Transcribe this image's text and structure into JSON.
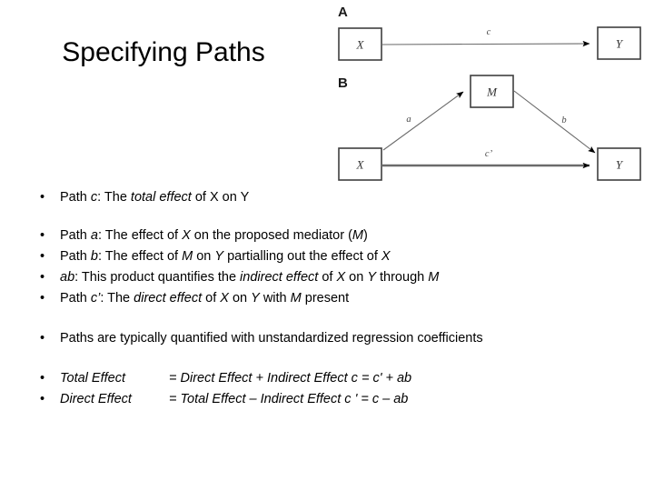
{
  "slide": {
    "title": "Specifying Paths"
  },
  "diagram": {
    "panel_a": {
      "label": "A",
      "nodes": [
        {
          "id": "x",
          "label": "X"
        },
        {
          "id": "y",
          "label": "Y"
        }
      ],
      "edges": [
        {
          "from": "X",
          "to": "Y",
          "label": "c"
        }
      ]
    },
    "panel_b": {
      "label": "B",
      "nodes": [
        {
          "id": "x",
          "label": "X"
        },
        {
          "id": "m",
          "label": "M"
        },
        {
          "id": "y",
          "label": "Y"
        }
      ],
      "edges": [
        {
          "from": "X",
          "to": "M",
          "label": "a"
        },
        {
          "from": "M",
          "to": "Y",
          "label": "b"
        },
        {
          "from": "X",
          "to": "Y",
          "label": "c'"
        }
      ]
    },
    "colors": {
      "box_stroke": "#3f3f3f",
      "line": "#6b6b6b",
      "arrowhead": "#000000",
      "text": "#333333"
    }
  },
  "bullets": {
    "marker": "•",
    "group1": [
      {
        "parts": [
          {
            "text": "Path ",
            "italic": false
          },
          {
            "text": "c",
            "italic": true
          },
          {
            "text": ": The ",
            "italic": false
          },
          {
            "text": "total effect",
            "italic": true
          },
          {
            "text": " of X on Y",
            "italic": false
          }
        ]
      }
    ],
    "group2": [
      {
        "parts": [
          {
            "text": "Path ",
            "italic": false
          },
          {
            "text": "a",
            "italic": true
          },
          {
            "text": ": The effect of ",
            "italic": false
          },
          {
            "text": "X",
            "italic": true
          },
          {
            "text": " on the proposed mediator (",
            "italic": false
          },
          {
            "text": "M",
            "italic": true
          },
          {
            "text": ")",
            "italic": false
          }
        ]
      },
      {
        "parts": [
          {
            "text": "Path ",
            "italic": false
          },
          {
            "text": "b",
            "italic": true
          },
          {
            "text": ": The effect of ",
            "italic": false
          },
          {
            "text": "M",
            "italic": true
          },
          {
            "text": " on ",
            "italic": false
          },
          {
            "text": "Y",
            "italic": true
          },
          {
            "text": " partialling out the effect of ",
            "italic": false
          },
          {
            "text": "X",
            "italic": true
          }
        ]
      },
      {
        "parts": [
          {
            "text": "ab",
            "italic": true
          },
          {
            "text": ": This product quantifies the ",
            "italic": false
          },
          {
            "text": "indirect effect",
            "italic": true
          },
          {
            "text": " of ",
            "italic": false
          },
          {
            "text": "X",
            "italic": true
          },
          {
            "text": " on ",
            "italic": false
          },
          {
            "text": "Y",
            "italic": true
          },
          {
            "text": " through ",
            "italic": false
          },
          {
            "text": "M",
            "italic": true
          }
        ]
      },
      {
        "parts": [
          {
            "text": "Path ",
            "italic": false
          },
          {
            "text": "c’",
            "italic": true
          },
          {
            "text": ": The ",
            "italic": false
          },
          {
            "text": "direct effect",
            "italic": true
          },
          {
            "text": " of ",
            "italic": false
          },
          {
            "text": "X",
            "italic": true
          },
          {
            "text": " on ",
            "italic": false
          },
          {
            "text": "Y",
            "italic": true
          },
          {
            "text": " with ",
            "italic": false
          },
          {
            "text": "M",
            "italic": true
          },
          {
            "text": " present",
            "italic": false
          }
        ]
      }
    ],
    "group3": [
      {
        "parts": [
          {
            "text": "Paths are typically quantified with unstandardized regression coefficients",
            "italic": false
          }
        ]
      }
    ]
  },
  "equations": [
    {
      "label": "Total Effect",
      "expression": "= Direct Effect + Indirect Effect  c  = c' + ab"
    },
    {
      "label": "Direct Effect",
      "expression": "= Total Effect – Indirect Effect   c ' = c – ab"
    }
  ]
}
